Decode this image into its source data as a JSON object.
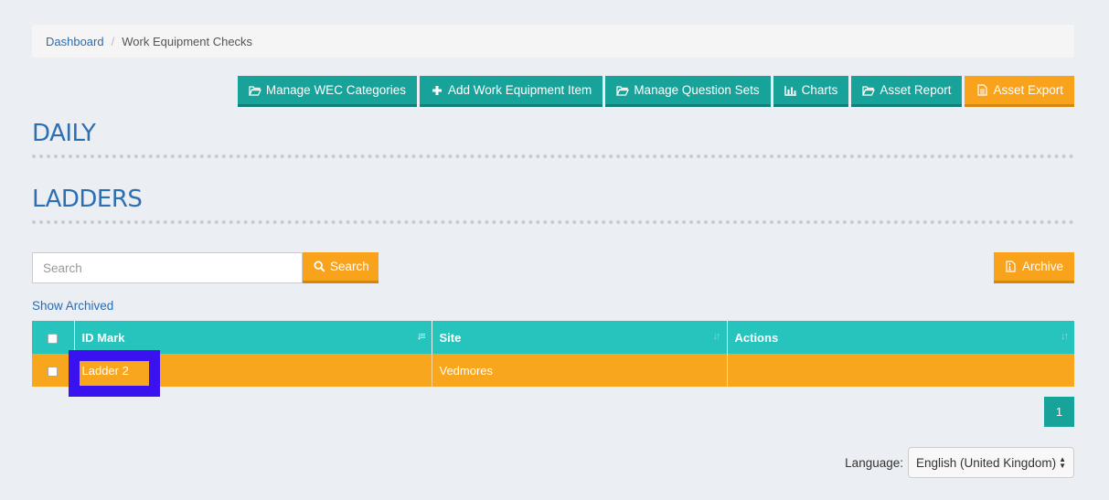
{
  "breadcrumb": {
    "home": "Dashboard",
    "current": "Work Equipment Checks"
  },
  "toolbar": {
    "manage_categories": "Manage WEC Categories",
    "add_item": "Add Work Equipment Item",
    "manage_questions": "Manage Question Sets",
    "charts": "Charts",
    "asset_report": "Asset Report",
    "asset_export": "Asset Export"
  },
  "sections": {
    "daily": "DAILY",
    "ladders": "LADDERS"
  },
  "search": {
    "placeholder": "Search",
    "button": "Search"
  },
  "archive_label": "Archive",
  "show_archived": "Show Archived",
  "table": {
    "headers": {
      "id_mark": "ID Mark",
      "site": "Site",
      "actions": "Actions"
    },
    "rows": [
      {
        "id_mark": "Ladder 2",
        "site": "Vedmores",
        "actions": ""
      }
    ]
  },
  "pagination": {
    "current": "1"
  },
  "language": {
    "label": "Language:",
    "selected": "English (United Kingdom)"
  },
  "colors": {
    "teal": "#17a39a",
    "header_teal": "#27c4bd",
    "orange": "#f9a21c",
    "title_blue": "#2d6fb3",
    "highlight": "#3a12f0"
  }
}
